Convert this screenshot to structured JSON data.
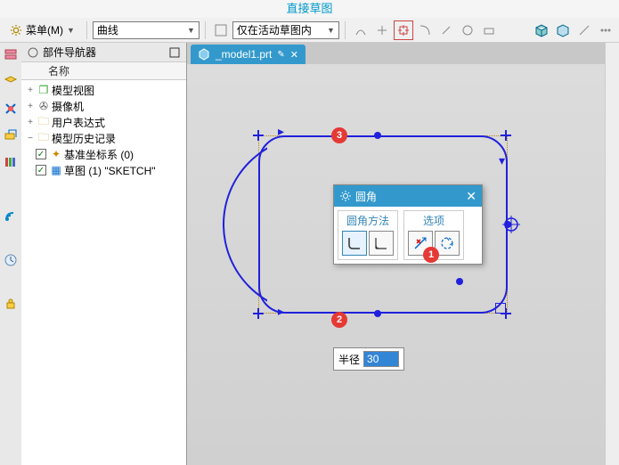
{
  "title": "直接草图",
  "menu": {
    "label": "菜单(M)"
  },
  "combos": {
    "curve": "曲线",
    "scope": "仅在活动草图内"
  },
  "nav": {
    "panel_title": "部件导航器",
    "col_name": "名称",
    "items": {
      "model_views": "模型视图",
      "cameras": "摄像机",
      "user_expr": "用户表达式",
      "history": "模型历史记录",
      "datum_csys": "基准坐标系 (0)",
      "sketch": "草图 (1) \"SKETCH\""
    }
  },
  "tab": {
    "label": "_model1.prt",
    "mod": "✎"
  },
  "popup": {
    "title": "圆角",
    "col_method": "圆角方法",
    "col_options": "选项"
  },
  "radius": {
    "label": "半径",
    "value": "30"
  },
  "badges": {
    "b1": "1",
    "b2": "2",
    "b3": "3"
  }
}
